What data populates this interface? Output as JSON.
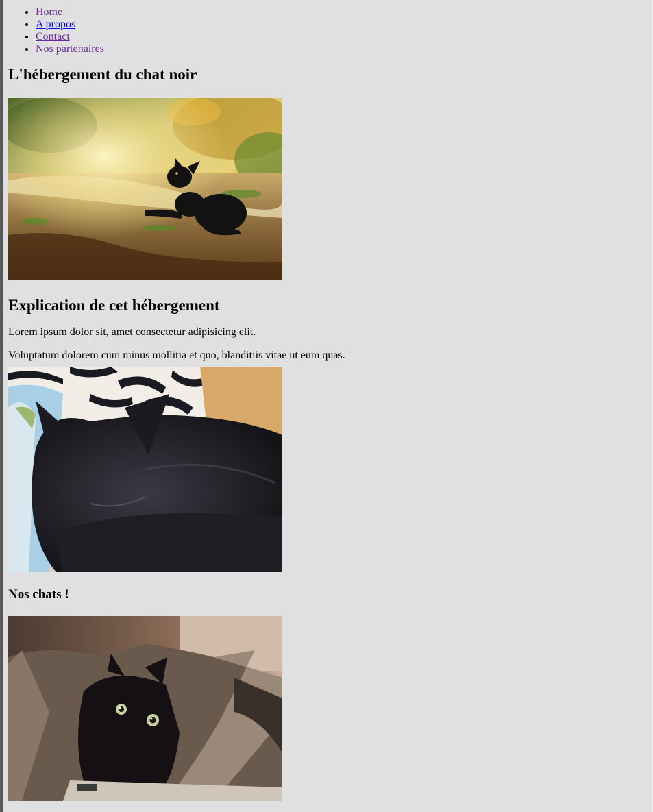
{
  "nav": {
    "items": [
      {
        "label": "Home"
      },
      {
        "label": "A propos"
      },
      {
        "label": "Contact"
      },
      {
        "label": "Nos partenaires"
      }
    ]
  },
  "main": {
    "title": "L'hébergement du chat noir",
    "section_title": "Explication de cet hébergement",
    "paragraphs": [
      "Lorem ipsum dolor sit, amet consectetur adipisicing elit.",
      "Voluptatum dolorem cum minus mollitia et quo, blanditiis vitae ut eum quas."
    ],
    "cats_title": "Nos chats !"
  },
  "colors": {
    "background": "#e0e0e0",
    "link_visited": "#6a2a9a",
    "link_active": "#0000ee"
  },
  "images": [
    {
      "icon": "black-cat-in-sunlit-garden-photo"
    },
    {
      "icon": "black-cat-sleeping-on-blanket-photo"
    },
    {
      "icon": "black-cat-in-paper-bag-photo"
    }
  ]
}
